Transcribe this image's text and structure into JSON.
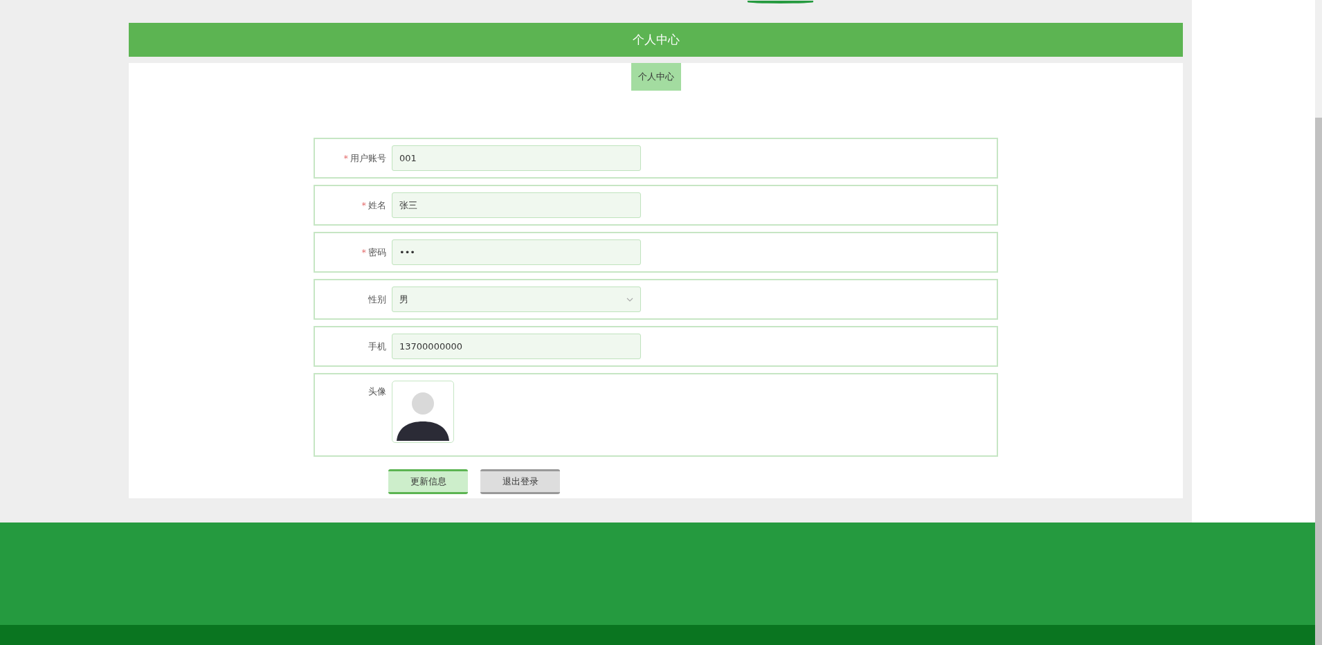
{
  "header": {
    "title": "个人中心"
  },
  "tabs": [
    {
      "label": "个人中心",
      "selected": true
    }
  ],
  "form": {
    "fields": [
      {
        "kind": "text",
        "label": "用户账号",
        "required_mark": "*",
        "value": "001"
      },
      {
        "kind": "text",
        "label": "姓名",
        "required_mark": "*",
        "value": "张三"
      },
      {
        "kind": "password",
        "label": "密码",
        "required_mark": "*",
        "value": "•••"
      },
      {
        "kind": "select",
        "label": "性别",
        "value": "男"
      },
      {
        "kind": "text",
        "label": "手机",
        "value": "13700000000"
      },
      {
        "kind": "image",
        "label": "头像"
      }
    ]
  },
  "buttons": [
    {
      "label": "更新信息",
      "kind": "primary"
    },
    {
      "label": "退出登录",
      "kind": "secondary"
    }
  ]
}
